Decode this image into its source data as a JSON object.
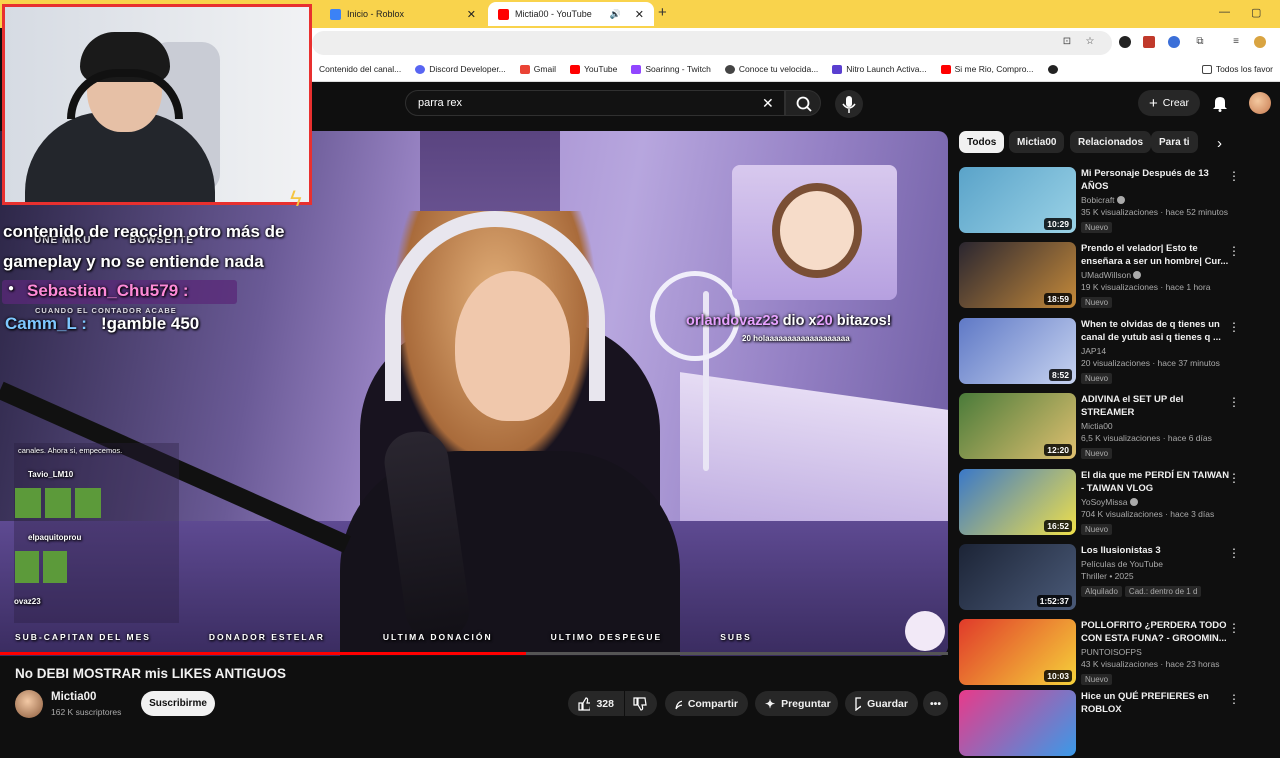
{
  "browser": {
    "tabs": [
      {
        "title": "Inicio - Roblox",
        "favicon_color": "#3b82f6"
      },
      {
        "title": "Mictia00 - YouTube",
        "favicon_color": "#ff0000"
      }
    ],
    "bookmarks": [
      {
        "label": "Contenido del canal...",
        "color": "#ff0000"
      },
      {
        "label": "Discord Developer...",
        "color": "#5865f2"
      },
      {
        "label": "Gmail",
        "color": "#ea4335"
      },
      {
        "label": "YouTube",
        "color": "#ff0000"
      },
      {
        "label": "Soarinng - Twitch",
        "color": "#9146ff"
      },
      {
        "label": "Conoce tu velocida...",
        "color": "#444444"
      },
      {
        "label": "Nitro Launch Activa...",
        "color": "#5a3fd0"
      },
      {
        "label": "Si me Rio, Compro...",
        "color": "#ff0000"
      },
      {
        "label": "",
        "color": "#222222"
      }
    ],
    "all_bookmarks": "Todos los favor"
  },
  "youtube": {
    "search_value": "parra rex",
    "create_label": "Crear",
    "video": {
      "title": "No DEBI MOSTRAR mis LIKES ANTIGUOS",
      "progress": 0.555,
      "overlay": {
        "chat_main": "contenido de reaccion otro más de gameplay y no se entiende nada",
        "chat_user": "Sebastian_Chu579 :",
        "chat_line2_user": "Camm_L :",
        "chat_line2_text": "!gamble 450",
        "alert_user": "orlandovaz23",
        "alert_mid": " dio x",
        "alert_num": "20",
        "alert_end": " bitazos!",
        "alert_sub": "20 holaaaaaaaaaaaaaaaaaaa",
        "left_small": "canales. Ahora si, empecemos.",
        "user_a": "Tavio_LM10",
        "user_b": "elpaquitoprou",
        "user_c": "ovaz23",
        "names_top": "UNE MIKU          BOWSETTE",
        "counter_label": "CUANDO EL CONTADOR ACABE",
        "footer": [
          "SUB-CAPITAN DEL MES",
          "DONADOR ESTELAR",
          "ULTIMA DONACIÓN",
          "ULTIMO DESPEGUE",
          "SUBS"
        ]
      }
    },
    "channel": {
      "name": "Mictia00",
      "subs": "162 K suscriptores",
      "subscribe_label": "Suscribirme"
    },
    "actions": {
      "likes": "328",
      "share": "Compartir",
      "ask": "Preguntar",
      "save": "Guardar"
    },
    "chips": [
      "Todos",
      "Mictia00",
      "Relacionados",
      "Para ti"
    ],
    "recommendations": [
      {
        "title": "Mi Personaje Después de 13 AÑOS",
        "channel": "Bobicraft",
        "verified": true,
        "views": "35 K visualizaciones · hace 52 minutos",
        "badges": [
          "Nuevo"
        ],
        "duration": "10:29",
        "thumb": [
          "#5aa3c9",
          "#9ad2e6"
        ]
      },
      {
        "title": "Prendo el velador| Esto te enseñara a ser un hombre| Cur...",
        "channel": "UMadWillson",
        "verified": true,
        "views": "19 K visualizaciones · hace 1 hora",
        "badges": [
          "Nuevo"
        ],
        "duration": "18:59",
        "thumb": [
          "#2a2630",
          "#c58a3a"
        ]
      },
      {
        "title": "When te olvidas de q tienes un canal de yutub asi q tienes q ...",
        "channel": "JAP14",
        "verified": false,
        "views": "20 visualizaciones · hace 37 minutos",
        "badges": [
          "Nuevo"
        ],
        "duration": "8:52",
        "thumb": [
          "#5f79c6",
          "#c7d3f0"
        ]
      },
      {
        "title": "ADIVINA el SET UP del STREAMER",
        "channel": "Mictia00",
        "verified": false,
        "views": "6,5 K visualizaciones · hace 6 días",
        "badges": [
          "Nuevo"
        ],
        "duration": "12:20",
        "thumb": [
          "#4a7b3a",
          "#e0c070"
        ]
      },
      {
        "title": "El dia que me PERDÍ EN TAIWAN - TAIWAN VLOG",
        "channel": "YoSoyMissa",
        "verified": true,
        "views": "704 K visualizaciones · hace 3 días",
        "badges": [
          "Nuevo"
        ],
        "duration": "16:52",
        "thumb": [
          "#3a78c8",
          "#f0e04a"
        ]
      },
      {
        "title": "Los Ilusionistas 3",
        "channel": "Películas de YouTube",
        "verified": false,
        "views": "Thriller • 2025",
        "badges": [
          "Alquilado",
          "Cad.: dentro de 1 d"
        ],
        "duration": "1:52:37",
        "thumb": [
          "#1c2436",
          "#4a5a78"
        ]
      },
      {
        "title": "POLLOFRITO ¿PERDERA TODO CON ESTA FUNA? - GROOMIN...",
        "channel": "PUNTOISOFPS",
        "verified": false,
        "views": "43 K visualizaciones · hace 23 horas",
        "badges": [
          "Nuevo"
        ],
        "duration": "10:03",
        "thumb": [
          "#e03a2a",
          "#f6d23a"
        ]
      },
      {
        "title": "Hice un QUÉ PREFIERES en ROBLOX",
        "channel": "",
        "verified": false,
        "views": "",
        "badges": [],
        "duration": "",
        "thumb": [
          "#e83a8a",
          "#3a9ae8"
        ]
      }
    ]
  }
}
